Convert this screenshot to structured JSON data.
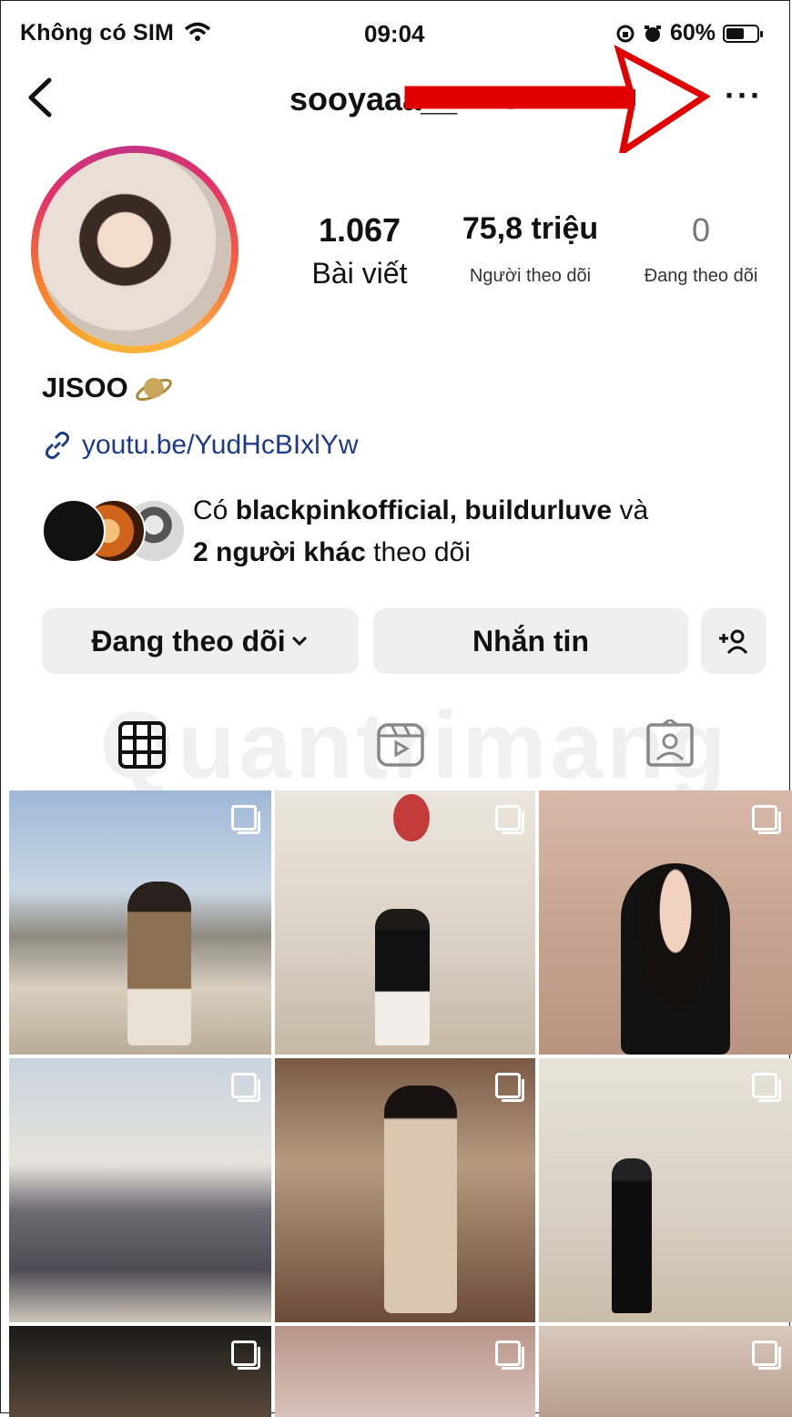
{
  "status_bar": {
    "carrier": "Không có SIM",
    "time": "09:04",
    "battery": "60%",
    "battery_level": 0.6
  },
  "header": {
    "username": "sooyaaa__",
    "more_label": "···"
  },
  "profile": {
    "posts_count": "1.067",
    "posts_label": "Bài viết",
    "followers_count": "75,8 triệu",
    "followers_label": "Người theo dõi",
    "following_count": "0",
    "following_label": "Đang theo dõi",
    "display_name": "JISOO",
    "link": "youtu.be/YudHcBIxlYw",
    "mutual_prefix": "Có ",
    "mutual_names": "blackpinkofficial, buildurluve",
    "mutual_and": " và ",
    "mutual_count": "2 người khác",
    "mutual_suffix": " theo dõi"
  },
  "actions": {
    "following_button": "Đang theo dõi",
    "message_button": "Nhắn tin"
  },
  "watermark": "Quantrimang",
  "colors": {
    "annotation_arrow": "#e10000",
    "link": "#1e3a8a",
    "button_bg": "#efefef"
  }
}
